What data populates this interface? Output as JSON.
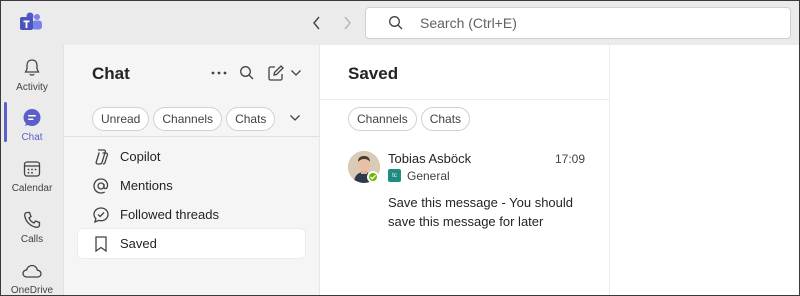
{
  "titlebar": {
    "search_placeholder": "Search (Ctrl+E)"
  },
  "rail": {
    "items": [
      {
        "label": "Activity",
        "icon": "bell-icon"
      },
      {
        "label": "Chat",
        "icon": "chat-icon",
        "active": true
      },
      {
        "label": "Calendar",
        "icon": "calendar-icon"
      },
      {
        "label": "Calls",
        "icon": "phone-icon"
      },
      {
        "label": "OneDrive",
        "icon": "cloud-icon"
      }
    ],
    "accent_color": "#5b5fc7"
  },
  "chatpane": {
    "title": "Chat",
    "filters": [
      "Unread",
      "Channels",
      "Chats"
    ],
    "nav": [
      {
        "label": "Copilot",
        "icon": "copilot-icon"
      },
      {
        "label": "Mentions",
        "icon": "at-icon"
      },
      {
        "label": "Followed threads",
        "icon": "followed-threads-icon"
      },
      {
        "label": "Saved",
        "icon": "bookmark-icon",
        "selected": true
      }
    ]
  },
  "savedpane": {
    "title": "Saved",
    "filters": [
      "Channels",
      "Chats"
    ],
    "message": {
      "author": "Tobias Asböck",
      "time": "17:09",
      "channel_badge": "tc",
      "channel": "General",
      "body": "Save this message - You should save this message for later",
      "presence_color": "#6bb700"
    }
  }
}
